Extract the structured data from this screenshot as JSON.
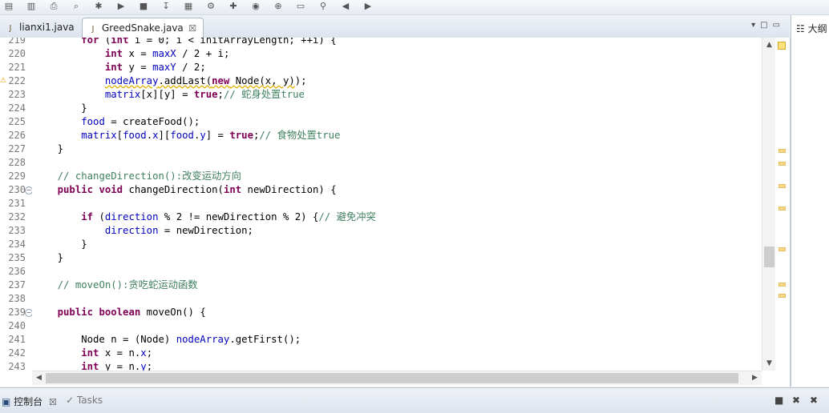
{
  "toolbar": {
    "icons": [
      "save-icon",
      "save-all-icon",
      "print-icon",
      "search-icon",
      "debug-icon",
      "run-icon",
      "stop-icon",
      "step-icon",
      "package-icon",
      "build-icon",
      "new-java-project-icon",
      "new-class-icon",
      "open-type-icon",
      "open-folder-icon",
      "search-menu-icon",
      "back-icon",
      "forward-icon"
    ]
  },
  "tabs": [
    {
      "label": "lianxi1.java",
      "active": false
    },
    {
      "label": "GreedSnake.java",
      "active": true,
      "close": "☒"
    }
  ],
  "tab_controls": [
    "▾",
    "□",
    "▭"
  ],
  "outline": {
    "label": "大纲"
  },
  "bottom": {
    "console_label": "控制台",
    "console_close": "☒",
    "tasks_label": "Tasks",
    "controls": [
      "■",
      "✖",
      "✖"
    ]
  },
  "code": [
    {
      "n": "219",
      "html": "    <span class=\"kw\">for</span> (<span class=\"kw\">int</span> i = 0; i &lt; initArrayLength; ++i) {"
    },
    {
      "n": "220",
      "html": "        <span class=\"kw\">int</span> x = <span class=\"fld\">maxX</span> / 2 + i;"
    },
    {
      "n": "221",
      "html": "        <span class=\"kw\">int</span> y = <span class=\"fld\">maxY</span> / 2;"
    },
    {
      "n": "222",
      "warn": true,
      "html": "        <span class=\"fld wavy\">nodeArray</span><span class=\"wavy\">.addLast(</span><span class=\"kw wavy\">new</span><span class=\"wavy\"> Node(x, y)</span>);"
    },
    {
      "n": "223",
      "html": "        <span class=\"fld\">matrix</span>[x][y] = <span class=\"kw\">true</span>;<span class=\"cm\">// 蛇身处置true</span>"
    },
    {
      "n": "224",
      "html": "    }"
    },
    {
      "n": "225",
      "html": "    <span class=\"fld\">food</span> = createFood();"
    },
    {
      "n": "226",
      "html": "    <span class=\"fld\">matrix</span>[<span class=\"fld\">food</span>.<span class=\"fld\">x</span>][<span class=\"fld\">food</span>.<span class=\"fld\">y</span>] = <span class=\"kw\">true</span>;<span class=\"cm\">// 食物处置true</span>"
    },
    {
      "n": "227",
      "html": "}"
    },
    {
      "n": "228",
      "html": ""
    },
    {
      "n": "229",
      "html": "<span class=\"cm\">// changeDirection():改变运动方向</span>"
    },
    {
      "n": "230",
      "fold": true,
      "html": "<span class=\"kw\">public void</span> changeDirection(<span class=\"kw\">int</span> newDirection) {"
    },
    {
      "n": "231",
      "html": ""
    },
    {
      "n": "232",
      "html": "    <span class=\"kw\">if</span> (<span class=\"fld\">direction</span> % 2 != newDirection % 2) {<span class=\"cm\">// 避免冲突</span>"
    },
    {
      "n": "233",
      "html": "        <span class=\"fld\">direction</span> = newDirection;"
    },
    {
      "n": "234",
      "html": "    }"
    },
    {
      "n": "235",
      "html": "}"
    },
    {
      "n": "236",
      "html": ""
    },
    {
      "n": "237",
      "html": "<span class=\"cm\">// moveOn():贪吃蛇运动函数</span>"
    },
    {
      "n": "238",
      "html": ""
    },
    {
      "n": "239",
      "fold": true,
      "html": "<span class=\"kw\">public boolean</span> moveOn() {"
    },
    {
      "n": "240",
      "html": ""
    },
    {
      "n": "241",
      "html": "    Node n = (Node) <span class=\"fld\">nodeArray</span>.getFirst();"
    },
    {
      "n": "242",
      "html": "    <span class=\"kw\">int</span> x = n.<span class=\"fld\">x</span>;"
    },
    {
      "n": "243",
      "html": "    <span class=\"kw\">int</span> y = n.<span class=\"fld\">y</span>;"
    }
  ]
}
